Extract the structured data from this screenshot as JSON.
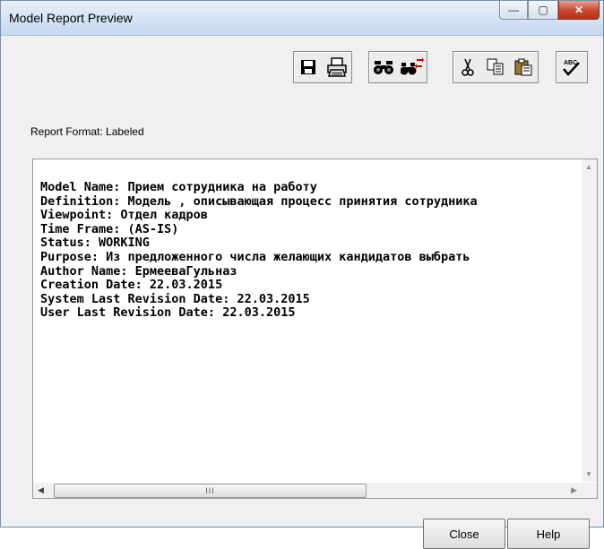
{
  "window": {
    "title": "Model Report Preview"
  },
  "title_controls": [
    {
      "name": "minimize-button",
      "glyph": "—"
    },
    {
      "name": "maximize-button",
      "glyph": "▢"
    },
    {
      "name": "close-window-button",
      "glyph": "✕"
    }
  ],
  "toolbar": {
    "icons": [
      "save-icon",
      "print-icon",
      "find-icon",
      "find-replace-icon",
      "cut-icon",
      "copy-icon",
      "paste-icon",
      "spellcheck-icon"
    ],
    "spell_label": "ABC"
  },
  "report_format_label": "Report Format: Labeled",
  "report_lines": [
    "Model Name: Прием сотрудника на работу",
    "Definition: Модель , описывающая процесс принятия сотрудника",
    "Viewpoint: Отдел кадров",
    "Time Frame: (AS-IS)",
    "Status: WORKING",
    "Purpose: Из предложенного числа желающих кандидатов выбрать",
    "Author Name: ЕрмееваГульназ",
    "Creation Date: 22.03.2015",
    "System Last Revision Date: 22.03.2015",
    "User Last Revision Date: 22.03.2015"
  ],
  "scroll": {
    "grip": "III"
  },
  "buttons": {
    "close": "Close",
    "help": "Help"
  }
}
